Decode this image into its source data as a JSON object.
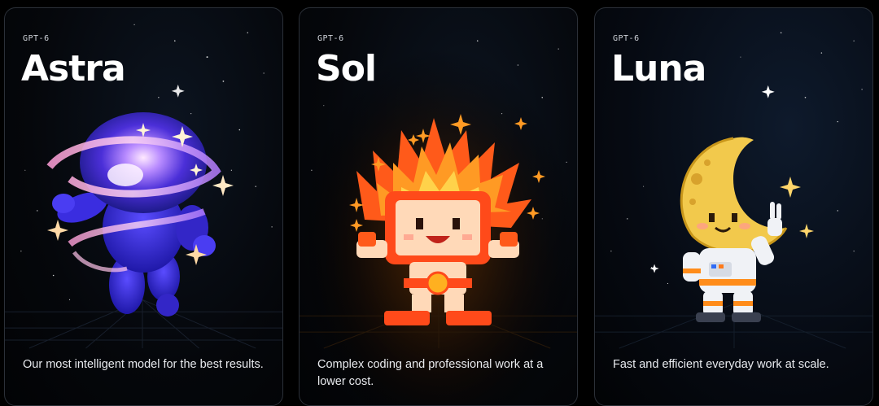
{
  "cards": [
    {
      "tag": "GPT-6",
      "name": "Astra",
      "description": "Our most intelligent model for the best results.",
      "illustration_icon": "galaxy-character-icon"
    },
    {
      "tag": "GPT-6",
      "name": "Sol",
      "description": "Complex coding and professional work at a lower cost.",
      "illustration_icon": "sun-character-icon"
    },
    {
      "tag": "GPT-6",
      "name": "Luna",
      "description": "Fast and efficient everyday work at scale.",
      "illustration_icon": "moon-astronaut-icon"
    }
  ],
  "colors": {
    "background": "#000000",
    "card_border": "#2b3038",
    "astra_accent": "#4b2fd8",
    "sol_accent": "#ff8a1c",
    "luna_accent": "#f2c94c"
  }
}
